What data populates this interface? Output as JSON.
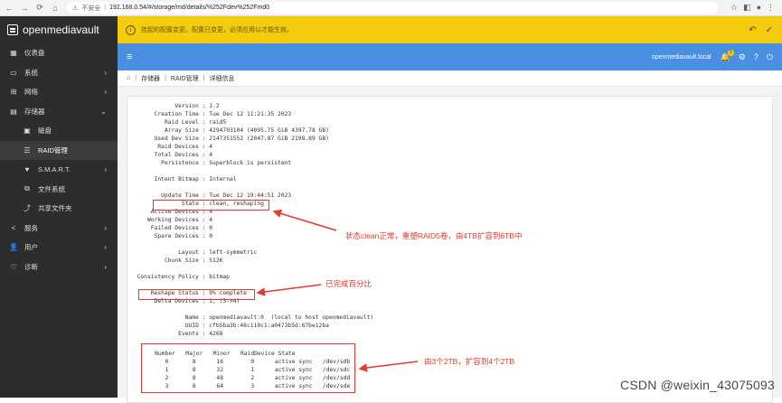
{
  "browser": {
    "security_label": "不安全",
    "url": "192.168.0.54/#/storage/md/details/%252Fdev%252Fmd0"
  },
  "sidebar": {
    "brand": "openmediavault",
    "items": [
      {
        "label": "仪表盘",
        "icon": "dashboard-icon"
      },
      {
        "label": "系统",
        "icon": "monitor-icon"
      },
      {
        "label": "网络",
        "icon": "network-icon"
      },
      {
        "label": "存储器",
        "icon": "storage-icon"
      },
      {
        "label": "磁盘",
        "icon": "disk-icon"
      },
      {
        "label": "RAID管理",
        "icon": "raid-icon"
      },
      {
        "label": "S.M.A.R.T.",
        "icon": "smart-icon"
      },
      {
        "label": "文件系统",
        "icon": "filesystem-icon"
      },
      {
        "label": "共享文件夹",
        "icon": "share-icon"
      },
      {
        "label": "服务",
        "icon": "services-icon"
      },
      {
        "label": "用户",
        "icon": "users-icon"
      },
      {
        "label": "诊断",
        "icon": "diagnostics-icon"
      }
    ]
  },
  "notice": {
    "text": "挂起的配置变更。配置已变更，必须应用以才能生效。"
  },
  "topbar": {
    "hostname": "openmediavault.local",
    "notification_count": "1"
  },
  "breadcrumb": {
    "items": [
      "存储器",
      "RAID管理",
      "详细信息"
    ]
  },
  "mdadm": {
    "lines": [
      "        Version : 1.2",
      "  Creation Time : Tue Dec 12 11:21:35 2023",
      "     Raid Level : raid5",
      "     Array Size : 4294703104 (4095.75 GiB 4397.78 GB)",
      "  Used Dev Size : 2147351552 (2047.87 GiB 2198.89 GB)",
      "   Raid Devices : 4",
      "  Total Devices : 4",
      "    Persistence : Superblock is persistent",
      "",
      "  Intent Bitmap : Internal",
      "",
      "    Update Time : Tue Dec 12 19:44:51 2023",
      "          State : clean, reshaping",
      " Active Devices : 4",
      "Working Devices : 4",
      " Failed Devices : 0",
      "  Spare Devices : 0",
      "",
      "         Layout : left-symmetric",
      "     Chunk Size : 512K",
      "",
      "Consistency Policy : bitmap",
      "",
      "  Reshape Status : 9% complete",
      "   Delta Devices : 1, (3->4)",
      "",
      "           Name : openmediavault:0  (local to host openmediavault)",
      "           UUID : cfb5ba3b:48c119c1:a0473b5d:67be12ba",
      "         Events : 4268",
      "",
      "    Number   Major   Minor   RaidDevice State",
      "       0       8      16        0      active sync   /dev/sdb",
      "       1       8      32        1      active sync   /dev/sdc",
      "       2       8      48        2      active sync   /dev/sdd",
      "       3       8      64        3      active sync   /dev/sde"
    ]
  },
  "annotations": {
    "state_note": "状态clean正常，重塑RAID5卷，由4TB扩容到6TB中",
    "reshape_note": "已完成百分比",
    "devices_note": "由3个2TB，扩容到4个2TB"
  },
  "watermark": "CSDN @weixin_43075093"
}
